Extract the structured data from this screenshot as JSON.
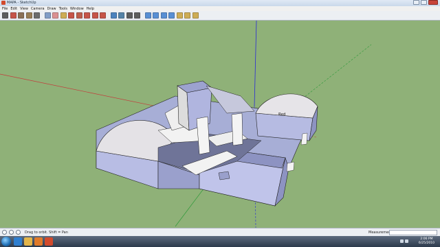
{
  "window": {
    "title": "MAPA - SketchUp"
  },
  "menu": {
    "items": [
      "File",
      "Edit",
      "View",
      "Camera",
      "Draw",
      "Tools",
      "Window",
      "Help"
    ]
  },
  "toolbar": {
    "tools": [
      {
        "name": "select-arrow-icon",
        "color": "#444444"
      },
      {
        "name": "line-pencil-icon",
        "color": "#c0392b"
      },
      {
        "name": "rectangle-icon",
        "color": "#7a5a3a"
      },
      {
        "name": "circle-icon",
        "color": "#8a6a3a"
      },
      {
        "name": "arc-icon",
        "color": "#555555"
      },
      {
        "name": "make-component-icon",
        "color": "#6f8fbf"
      },
      {
        "name": "eraser-icon",
        "color": "#d98080"
      },
      {
        "name": "tape-measure-icon",
        "color": "#c9a23a"
      },
      {
        "name": "paint-bucket-icon",
        "color": "#c0392b"
      },
      {
        "name": "push-pull-icon",
        "color": "#b5452f"
      },
      {
        "name": "move-icon",
        "color": "#c0392b"
      },
      {
        "name": "rotate-icon",
        "color": "#c0392b"
      },
      {
        "name": "offset-icon",
        "color": "#c0392b"
      },
      {
        "name": "orbit-icon",
        "color": "#2f6fb5"
      },
      {
        "name": "pan-icon",
        "color": "#3a6f9a"
      },
      {
        "name": "zoom-icon",
        "color": "#444444"
      },
      {
        "name": "zoom-extents-icon",
        "color": "#444444"
      },
      {
        "name": "get-models-icon",
        "color": "#3f7fcf"
      },
      {
        "name": "share-model-icon",
        "color": "#3f7fcf"
      },
      {
        "name": "share-component-icon",
        "color": "#3f7fcf"
      },
      {
        "name": "add-location-icon",
        "color": "#3f7fcf"
      },
      {
        "name": "toggle-terrain-icon",
        "color": "#c9a23a"
      },
      {
        "name": "photo-textures-icon",
        "color": "#c9a23a"
      },
      {
        "name": "preview-google-earth-icon",
        "color": "#c9a23a"
      }
    ]
  },
  "model": {
    "labels": [
      "Red"
    ]
  },
  "statusbar": {
    "hint": "Drag to orbit.  Shift = Pan",
    "measurements_label": "Measurements",
    "measurements_value": ""
  },
  "taskbar": {
    "time": "2:06 PM",
    "date": "6/25/2010",
    "apps": [
      {
        "name": "internet-explorer-icon",
        "color": "#2f7fd0"
      },
      {
        "name": "windows-explorer-icon",
        "color": "#e3b54a"
      },
      {
        "name": "media-player-icon",
        "color": "#e07a2a"
      },
      {
        "name": "sketchup-icon",
        "color": "#d24a2c"
      }
    ]
  }
}
